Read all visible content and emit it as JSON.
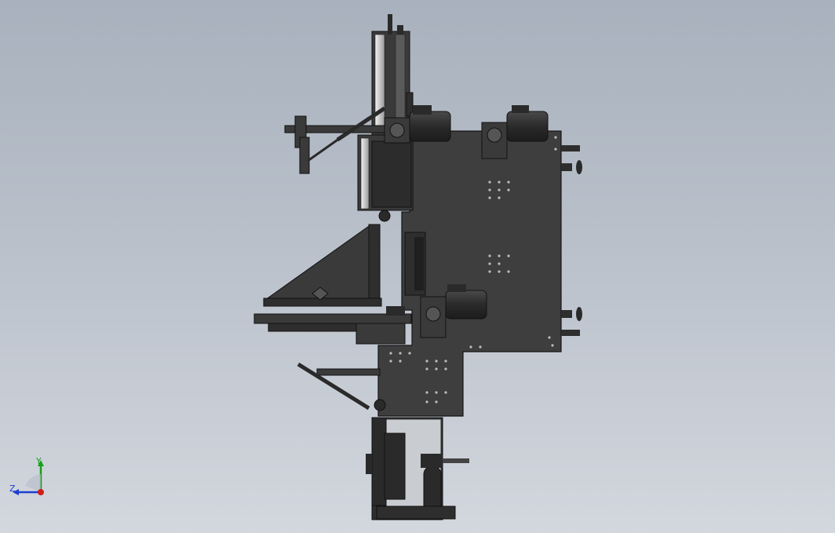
{
  "viewport": {
    "background_top": "#a8b1bd",
    "background_bottom": "#d3d7de"
  },
  "model": {
    "body_color": "#3a3a3a",
    "edge_color": "#1a1a1a",
    "light_part_color": "#e8e8e8",
    "motor_color": "#2b2b2b"
  },
  "triad": {
    "y_label": "Y",
    "z_label": "Z",
    "y_color": "#1a9e1a",
    "z_color": "#1a3fd1",
    "origin_color": "#d01c1c"
  }
}
